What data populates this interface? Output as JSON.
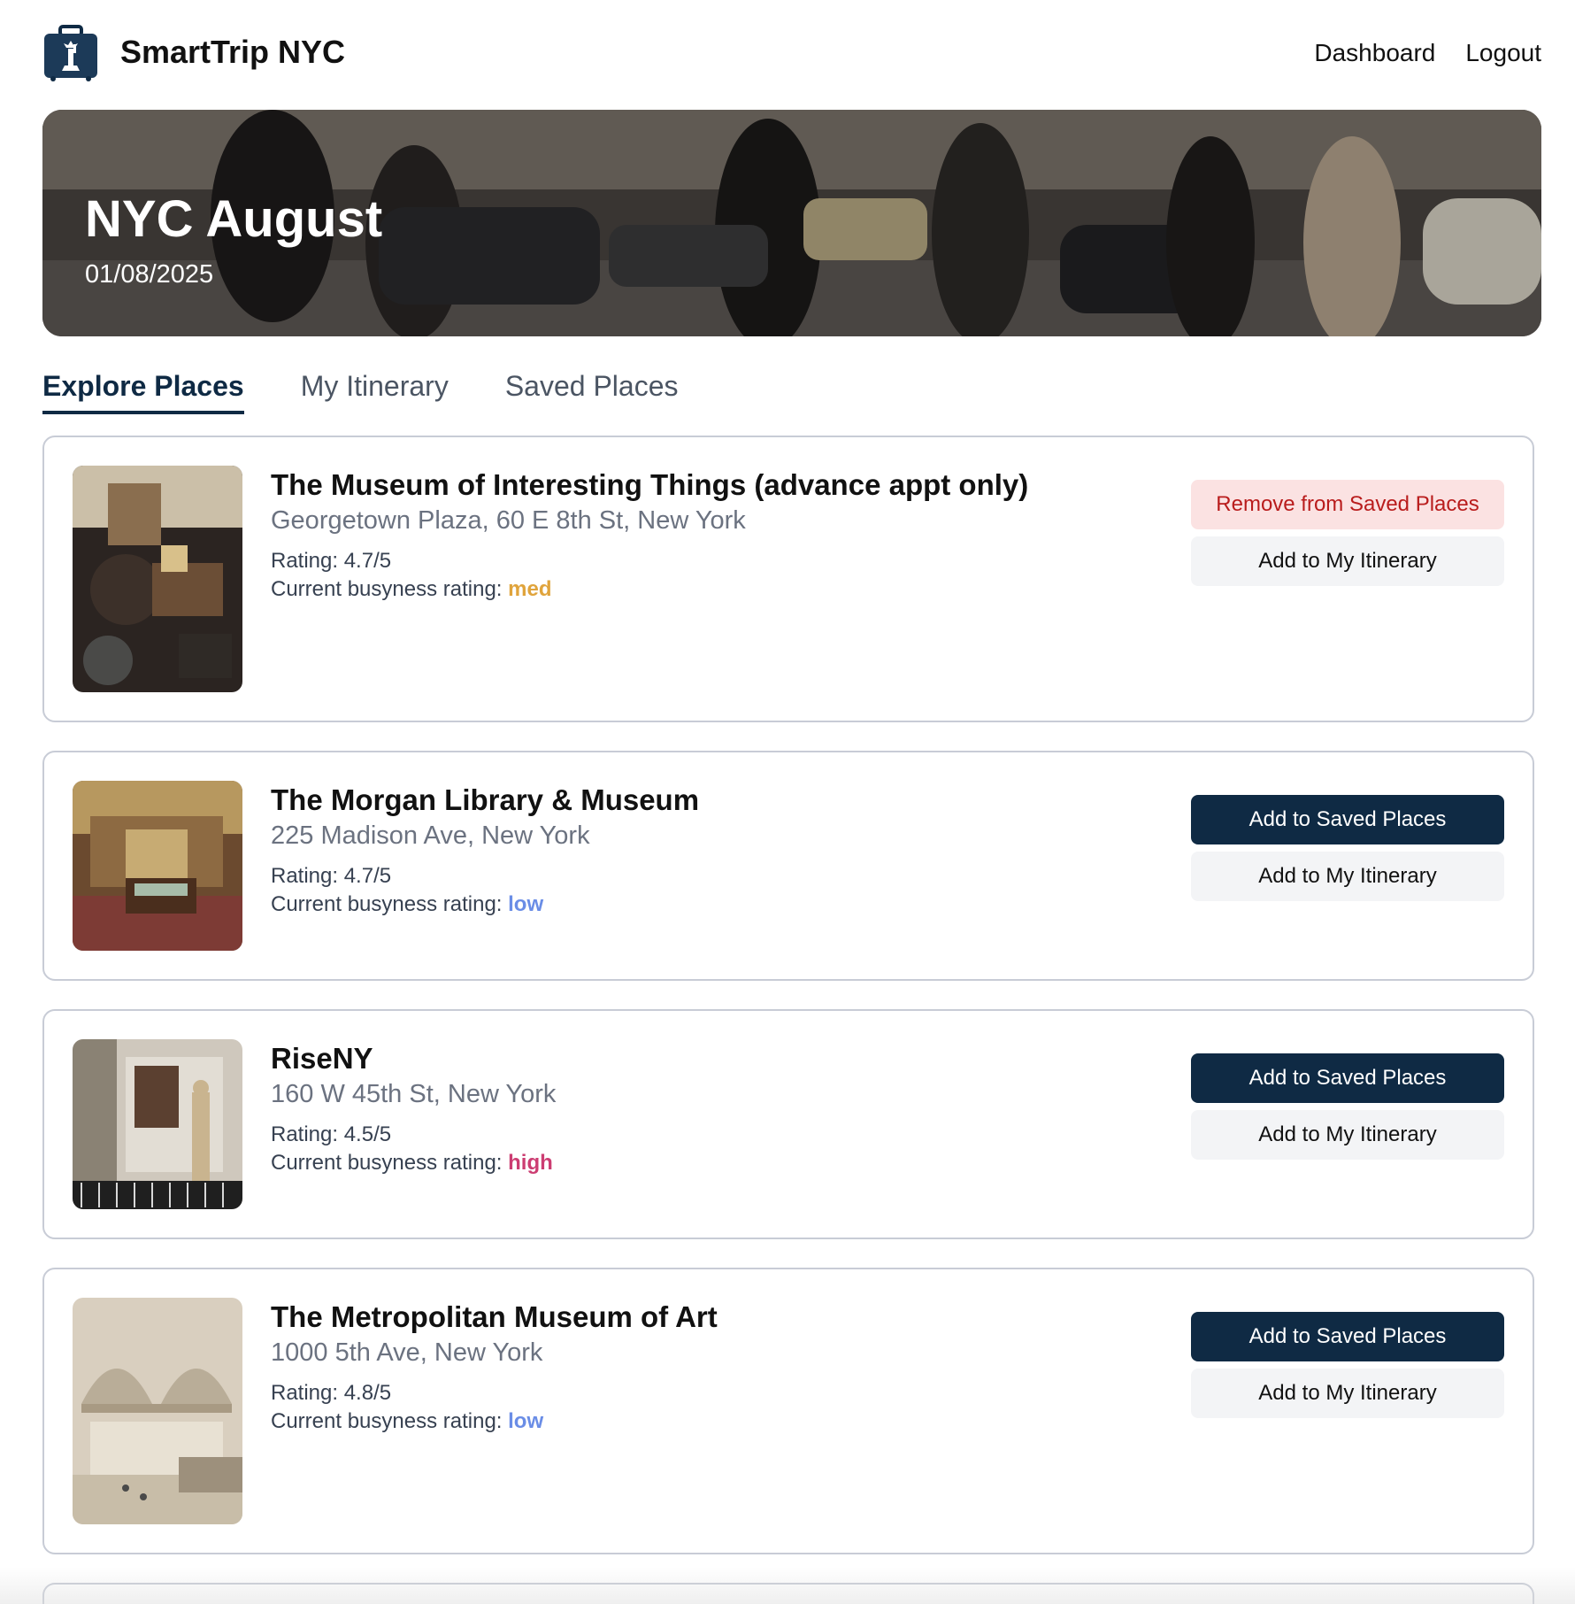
{
  "header": {
    "brand": "SmartTrip NYC",
    "logo_icon": "suitcase-statue-of-liberty-icon",
    "nav": [
      "Dashboard",
      "Logout"
    ]
  },
  "hero": {
    "title": "NYC August",
    "date": "01/08/2025"
  },
  "tabs": [
    "Explore Places",
    "My Itinerary",
    "Saved Places"
  ],
  "active_tab": "Explore Places",
  "colors": {
    "primary": "#0f2a44",
    "danger_bg": "#fbe2e2",
    "danger_text": "#b91c1c",
    "busy_low": "#6a8de6",
    "busy_med": "#e0a43c",
    "busy_high": "#cc3d72"
  },
  "places": [
    {
      "name": "The Museum of Interesting Things (advance appt only)",
      "address": "Georgetown Plaza, 60 E 8th St, New York",
      "rating": "Rating: 4.7/5",
      "busyness_label": "Current busyness rating: ",
      "busyness": "med",
      "primary_action": "Remove from Saved Places",
      "secondary_action": "Add to My Itinerary"
    },
    {
      "name": "The Morgan Library & Museum",
      "address": "225 Madison Ave, New York",
      "rating": "Rating: 4.7/5",
      "busyness_label": "Current busyness rating: ",
      "busyness": "low",
      "primary_action": "Add to Saved Places",
      "secondary_action": "Add to My Itinerary"
    },
    {
      "name": "RiseNY",
      "address": "160 W 45th St, New York",
      "rating": "Rating: 4.5/5",
      "busyness_label": "Current busyness rating: ",
      "busyness": "high",
      "primary_action": "Add to Saved Places",
      "secondary_action": "Add to My Itinerary"
    },
    {
      "name": "The Metropolitan Museum of Art",
      "address": "1000 5th Ave, New York",
      "rating": "Rating: 4.8/5",
      "busyness_label": "Current busyness rating: ",
      "busyness": "low",
      "primary_action": "Add to Saved Places",
      "secondary_action": "Add to My Itinerary"
    }
  ]
}
